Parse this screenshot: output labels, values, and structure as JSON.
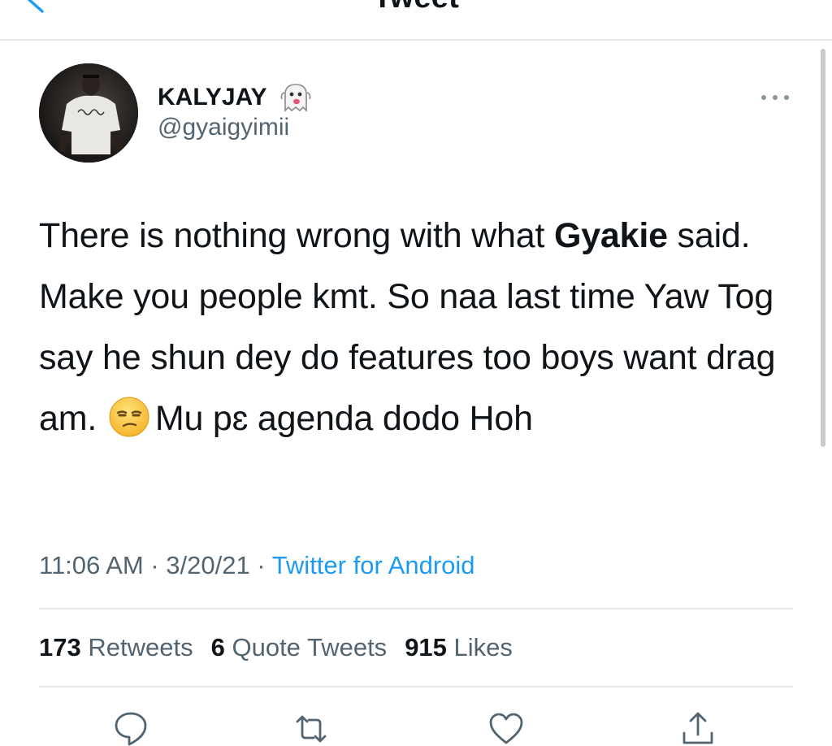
{
  "header": {
    "title": "Tweet",
    "back_icon": "chevron-left-icon"
  },
  "author": {
    "display_name": "KALYJAY",
    "name_emoji": "ghost-emoji",
    "handle": "@gyaigyimii",
    "avatar_icon": "profile-photo",
    "more_icon": "more-horizontal-icon"
  },
  "tweet": {
    "text_part1": "There is nothing wrong with what ",
    "mention_bold": "Gyakie",
    "text_part2": " said. Make you people kmt. So naa last time Yaw Tog say he shun dey do features too boys want drag am.",
    "inline_emoji": "unamused-face-emoji",
    "text_part3": "Mu pɛ agenda dodo Hoh"
  },
  "meta": {
    "time": "11:06 AM",
    "separator": " · ",
    "date": "3/20/21",
    "source": "Twitter for Android"
  },
  "stats": {
    "retweets_count": "173",
    "retweets_label": "Retweets",
    "quotes_count": "6",
    "quotes_label": "Quote Tweets",
    "likes_count": "915",
    "likes_label": "Likes"
  },
  "actions": {
    "reply_icon": "reply-icon",
    "retweet_icon": "retweet-icon",
    "like_icon": "heart-icon",
    "share_icon": "share-icon"
  },
  "colors": {
    "accent": "#1d9bf0",
    "text_primary": "#0f1419",
    "text_secondary": "#536471",
    "divider": "#e6e8ea"
  }
}
